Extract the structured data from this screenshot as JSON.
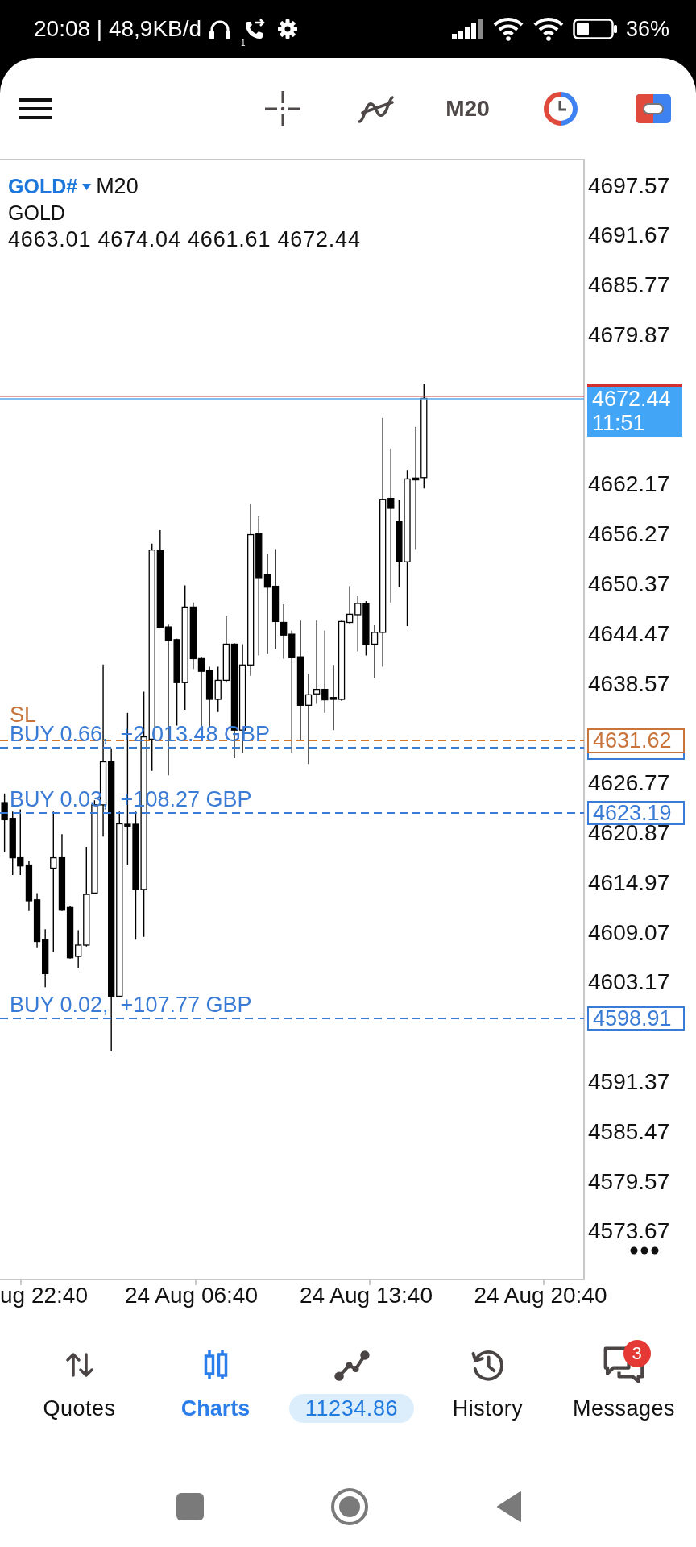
{
  "status_bar": {
    "text": "20:08 | 48,9KB/d",
    "sim_slot": "1",
    "battery": "36%"
  },
  "toolbar": {
    "timeframe": "M20"
  },
  "chart": {
    "symbol": "GOLD#",
    "timeframe": "M20",
    "description": "GOLD",
    "ohlc": "4663.01 4674.04 4661.61 4672.44",
    "price_axis": [
      "4697.57",
      "4691.67",
      "4685.77",
      "4679.87",
      "4662.17",
      "4656.27",
      "4650.37",
      "4644.47",
      "4638.57",
      "4626.77",
      "4620.87",
      "4614.97",
      "4609.07",
      "4603.17",
      "4591.37",
      "4585.47",
      "4579.57",
      "4573.67"
    ],
    "levels": [
      {
        "kind": "bid",
        "price": "4672.44",
        "countdown": "11:51"
      },
      {
        "kind": "stop_loss",
        "label": "SL",
        "price": "4631.62"
      },
      {
        "kind": "position",
        "label": "BUY 0.66,",
        "profit": "+2 013.48 GBP"
      },
      {
        "kind": "position",
        "label": "BUY 0.03,",
        "profit": "+108.27 GBP",
        "price": "4623.19"
      },
      {
        "kind": "position",
        "label": "BUY 0.02,",
        "profit": "+107.77 GBP",
        "price": "4598.91"
      }
    ],
    "time_axis": [
      "ug 22:40",
      "24 Aug 06:40",
      "24 Aug 13:40",
      "24 Aug 20:40"
    ]
  },
  "bottom_nav": [
    {
      "kind": "tab",
      "label": "Quotes",
      "selected": false
    },
    {
      "kind": "tab",
      "label": "Charts",
      "selected": true
    },
    {
      "kind": "balance",
      "balance": "11234.86",
      "selected": false
    },
    {
      "kind": "tab",
      "label": "History",
      "selected": false
    },
    {
      "kind": "tab",
      "label": "Messages",
      "selected": false,
      "badge": "3"
    }
  ]
}
